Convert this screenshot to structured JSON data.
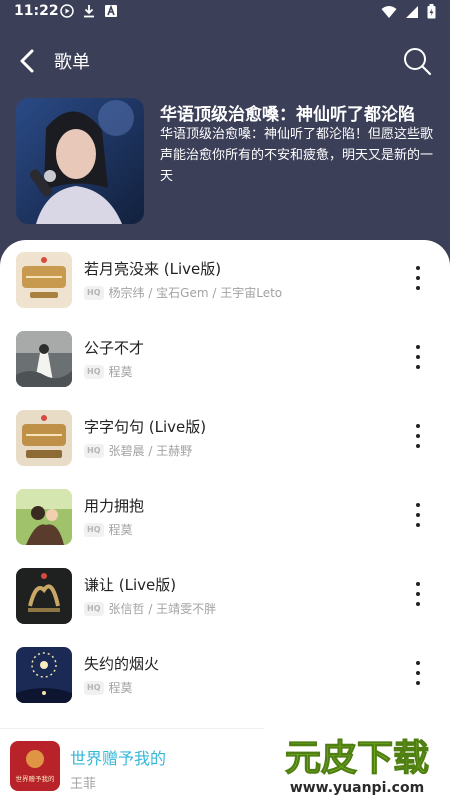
{
  "status_bar": {
    "time": "11:22",
    "left_icons": [
      "play-circle-icon",
      "download-icon",
      "notification-a-icon"
    ],
    "right_icons": [
      "wifi-icon",
      "signal-icon",
      "battery-icon"
    ]
  },
  "nav": {
    "title": "歌单",
    "back_icon": "chevron-left-icon",
    "search_icon": "search-icon"
  },
  "playlist": {
    "title": "华语顶级治愈嗓：神仙听了都沦陷",
    "description": "华语顶级治愈嗓：神仙听了都沦陷！但愿这些歌声能治愈你所有的不安和疲惫，明天又是新的一天"
  },
  "hq_label": "HQ",
  "songs": [
    {
      "title": "若月亮没来 (Live版)",
      "artist": "杨宗纬 / 宝石Gem / 王宇宙Leto"
    },
    {
      "title": "公子不才",
      "artist": "程莫"
    },
    {
      "title": "字字句句 (Live版)",
      "artist": "张碧晨 / 王赫野"
    },
    {
      "title": "用力拥抱",
      "artist": "程莫"
    },
    {
      "title": "谦让 (Live版)",
      "artist": "张信哲 / 王靖雯不胖"
    },
    {
      "title": "失约的烟火",
      "artist": "程莫"
    }
  ],
  "mini_player": {
    "title": "世界赠予我的",
    "artist": "王菲",
    "cover_text": "世界赠予我的"
  },
  "watermark": {
    "main": "元皮下载",
    "url": "www.yuanpi.com"
  },
  "colors": {
    "header_bg": "#3b3f57",
    "accent": "#37b7d8",
    "watermark_green": "#8fcf2e"
  }
}
